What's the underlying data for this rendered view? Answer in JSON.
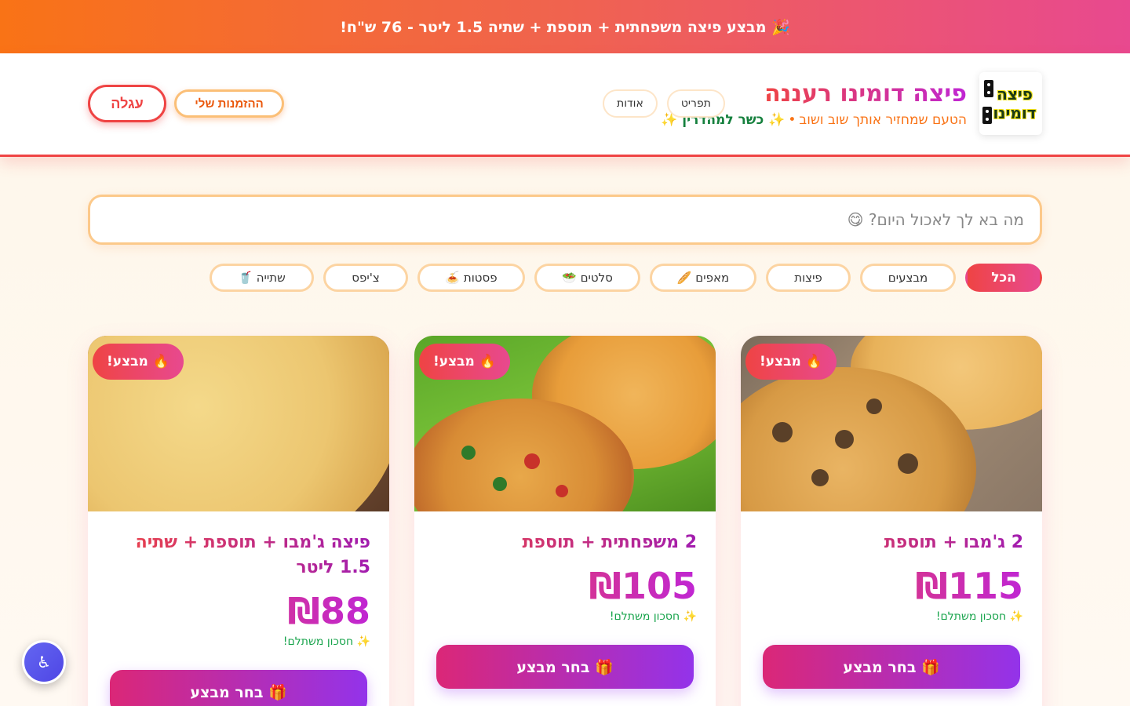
{
  "promo": {
    "text": "🎉 מבצע פיצה משפחתית + תוספת + שתיה 1.5 ליטר - 76 ש\"ח!"
  },
  "brand": {
    "title": "פיצה דומינו רעננה",
    "slogan": "הטעם שמחזיר אותך שוב ושוב",
    "separator": "•",
    "kosher": "✨ כשר למהדרין ✨",
    "logo_line1": "פיצה",
    "logo_line2": "דומינו"
  },
  "nav": {
    "menu": "תפריט",
    "about": "אודות"
  },
  "actions": {
    "cart": "עגלה",
    "my_orders": "ההזמנות שלי"
  },
  "search": {
    "placeholder": "מה בא לך לאכול היום? 😋"
  },
  "categories": [
    {
      "label": "הכל",
      "active": true
    },
    {
      "label": "מבצעים"
    },
    {
      "label": "פיצות"
    },
    {
      "label": "מאפים 🥖"
    },
    {
      "label": "סלטים 🥗"
    },
    {
      "label": "פסטות 🍝"
    },
    {
      "label": "צ'יפס"
    },
    {
      "label": "שתייה 🥤"
    }
  ],
  "products": [
    {
      "badge": "🔥 מבצע!",
      "title": "2 ג'מבו + תוספת",
      "price": "₪115",
      "savings": "✨ חסכון משתלם!",
      "button": "🎁 בחר מבצע"
    },
    {
      "badge": "🔥 מבצע!",
      "title": "2 משפחתית + תוספת",
      "price": "₪105",
      "savings": "✨ חסכון משתלם!",
      "button": "🎁 בחר מבצע"
    },
    {
      "badge": "🔥 מבצע!",
      "title": "פיצה ג'מבו + תוספת + שתיה 1.5 ליטר",
      "price": "₪88",
      "savings": "✨ חסכון משתלם!",
      "button": "🎁 בחר מבצע"
    }
  ],
  "accessibility": {
    "icon": "♿"
  },
  "colors": {
    "accent": "#ef4444",
    "secondary": "#f97316",
    "purple": "#9333ea",
    "green": "#16a34a"
  }
}
